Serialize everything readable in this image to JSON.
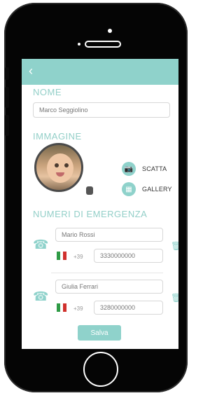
{
  "sections": {
    "name": "NOME",
    "image": "IMMAGINE",
    "emergency": "NUMERI DI EMERGENZA"
  },
  "fields": {
    "name_value": "Marco Seggiolino"
  },
  "image_actions": {
    "take": "SCATTA",
    "gallery": "GALLERY"
  },
  "contacts": [
    {
      "name": "Mario Rossi",
      "prefix": "+39",
      "phone": "3330000000"
    },
    {
      "name": "Giulia Ferrari",
      "prefix": "+39",
      "phone": "3280000000"
    }
  ],
  "buttons": {
    "save": "Salva",
    "back": "‹"
  },
  "colors": {
    "accent": "#8fd2cb",
    "flag_green": "#2f9b46",
    "flag_white": "#ffffff",
    "flag_red": "#d0312d"
  },
  "icons": {
    "back": "back-arrow-icon",
    "camera": "camera-icon",
    "gallery": "gallery-icon",
    "phone_add": "phone-add-icon",
    "trash": "trash-icon",
    "lock": "lock-icon"
  }
}
